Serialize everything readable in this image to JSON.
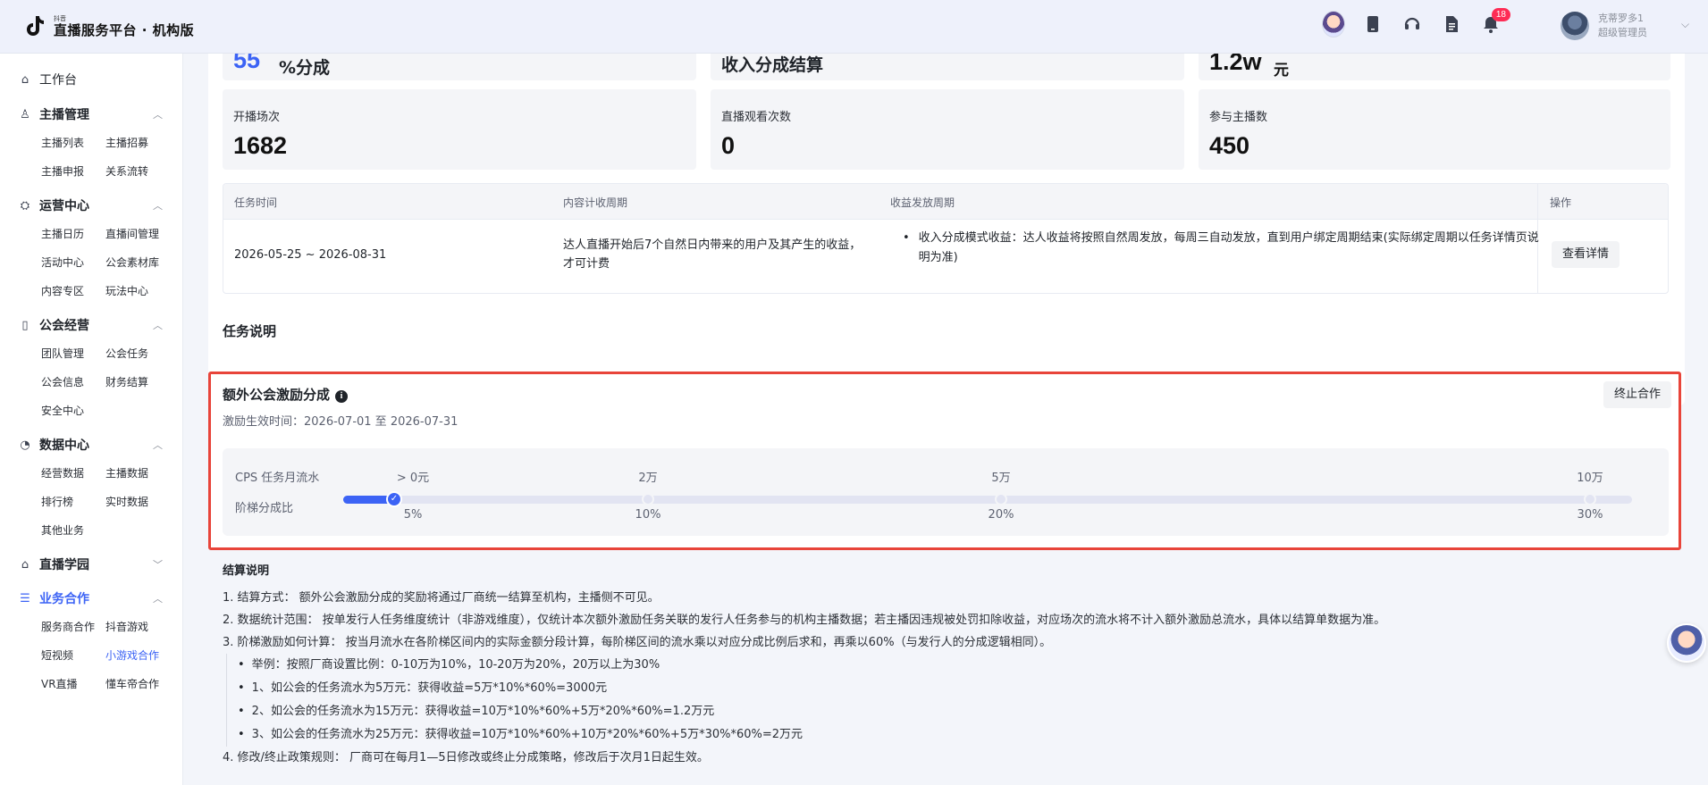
{
  "header": {
    "logo_small": "抖音",
    "logo_title": "直播服务平台 · 机构版",
    "notification_count": "18",
    "user_name": "克蒂罗多1",
    "user_role": "超级管理员"
  },
  "sidebar": {
    "home": "工作台",
    "groups": [
      {
        "title": "主播管理",
        "icon": "user-icon",
        "items": [
          "主播列表",
          "主播招募",
          "主播申报",
          "关系流转"
        ]
      },
      {
        "title": "运营中心",
        "icon": "operation-icon",
        "items": [
          "主播日历",
          "直播间管理",
          "活动中心",
          "公会素材库",
          "内容专区",
          "玩法中心"
        ]
      },
      {
        "title": "公会经营",
        "icon": "guild-icon",
        "items": [
          "团队管理",
          "公会任务",
          "公会信息",
          "财务结算",
          "安全中心"
        ]
      },
      {
        "title": "数据中心",
        "icon": "data-icon",
        "items": [
          "经营数据",
          "主播数据",
          "排行榜",
          "实时数据",
          "其他业务"
        ]
      },
      {
        "title": "直播学园",
        "icon": "school-icon",
        "items": []
      },
      {
        "title": "业务合作",
        "icon": "list-icon",
        "items": [
          "服务商合作",
          "抖音游戏",
          "短视频",
          "小游戏合作",
          "VR直播",
          "懂车帝合作"
        ]
      }
    ],
    "active_item": "小游戏合作"
  },
  "stats_top": {
    "share_value": "55",
    "share_unit": "%分成",
    "settle_title": "收入分成结算",
    "amount_value": "1.2w",
    "amount_unit": "元"
  },
  "stats": [
    {
      "label": "开播场次",
      "value": "1682"
    },
    {
      "label": "直播观看次数",
      "value": "0"
    },
    {
      "label": "参与主播数",
      "value": "450"
    }
  ],
  "table": {
    "headers": [
      "任务时间",
      "内容计收周期",
      "收益发放周期",
      "操作"
    ],
    "row": {
      "time": "2026-05-25 ~ 2026-08-31",
      "content_cycle": "达人直播开始后7个自然日内带来的用户及其产生的收益，才可计费",
      "payout_cycle": "收入分成模式收益：达人收益将按照自然周发放，每周三自动发放，直到用户绑定周期结束(实际绑定周期以任务详情页说明为准)",
      "action": "查看详情"
    }
  },
  "task_desc_title": "任务说明",
  "incentive": {
    "title": "额外公会激励分成",
    "stop_button": "终止合作",
    "effective_time": "激励生效时间：2026-07-01 至 2026-07-31",
    "row1_label": "CPS 任务月流水",
    "row2_label": "阶梯分成比",
    "tiers": [
      {
        "threshold": "> 0元",
        "ratio": "5%"
      },
      {
        "threshold": "2万",
        "ratio": "10%"
      },
      {
        "threshold": "5万",
        "ratio": "20%"
      },
      {
        "threshold": "10万",
        "ratio": "30%"
      }
    ],
    "current_tier_index": 0
  },
  "settlement": {
    "title": "结算说明",
    "line1": "1. 结算方式： 额外公会激励分成的奖励将通过厂商统一结算至机构，主播侧不可见。",
    "line2": "2. 数据统计范围： 按单发行人任务维度统计（非游戏维度），仅统计本次额外激励任务关联的发行人任务参与的机构主播数据；若主播因违规被处罚扣除收益，对应场次的流水将不计入额外激励总流水，具体以结算单数据为准。",
    "line3": "3. 阶梯激励如何计算： 按当月流水在各阶梯区间内的实际金额分段计算，每阶梯区间的流水乘以对应分成比例后求和，再乘以60%（与发行人的分成逻辑相同）。",
    "examples": [
      "举例：按照厂商设置比例：0-10万为10%，10-20万为20%，20万以上为30%",
      "1、如公会的任务流水为5万元：获得收益=5万*10%*60%=3000元",
      "2、如公会的任务流水为15万元：获得收益=10万*10%*60%+5万*20%*60%=1.2万元",
      "3、如公会的任务流水为25万元：获得收益=10万*10%*60%+10万*20%*60%+5万*30%*60%=2万元"
    ],
    "line4": "4. 修改/终止政策规则： 厂商可在每月1—5日修改或终止分成策略，修改后于次月1日起生效。"
  },
  "colors": {
    "accent": "#3c63f5",
    "highlight_border": "#e8443a",
    "badge": "#fe2c55"
  }
}
